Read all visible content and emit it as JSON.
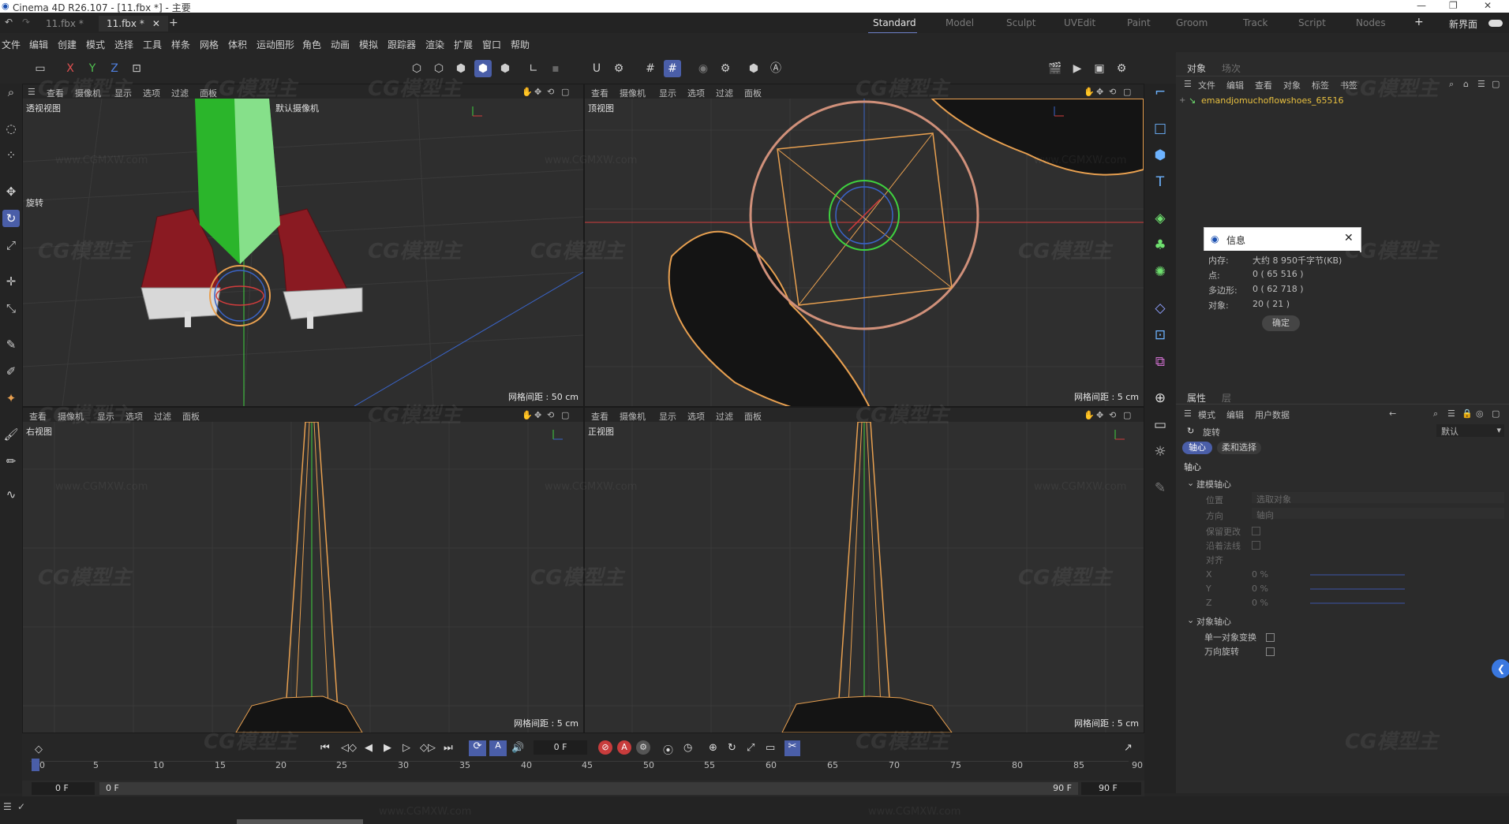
{
  "window": {
    "title": "Cinema 4D R26.107 - [11.fbx *] - 主要"
  },
  "doc_tabs": [
    {
      "label": "11.fbx *"
    },
    {
      "label": "11.fbx *"
    }
  ],
  "layout_tabs": [
    "Standard",
    "Model",
    "Sculpt",
    "UVEdit",
    "Paint",
    "Groom",
    "Track",
    "Script",
    "Nodes"
  ],
  "layout_extra": "新界面",
  "menu": [
    "文件",
    "编辑",
    "创建",
    "模式",
    "选择",
    "工具",
    "样条",
    "网格",
    "体积",
    "运动图形",
    "角色",
    "动画",
    "模拟",
    "跟踪器",
    "渲染",
    "扩展",
    "窗口",
    "帮助"
  ],
  "axis_buttons": [
    "X",
    "Y",
    "Z"
  ],
  "viewport_menu": [
    "查看",
    "摄像机",
    "显示",
    "选项",
    "过滤",
    "面板"
  ],
  "viewports": {
    "perspective": {
      "name": "透视视图",
      "camera": "默认摄像机",
      "rotate_label": "旋转",
      "grid": "网格间距 : 50 cm"
    },
    "top": {
      "name": "顶视图",
      "grid": "网格间距 : 5 cm"
    },
    "right": {
      "name": "右视图",
      "grid": "网格间距 : 5 cm"
    },
    "front": {
      "name": "正视图",
      "grid": "网格间距 : 5 cm"
    }
  },
  "object_panel": {
    "tab_active": "对象",
    "tab_inactive": "场次",
    "menu": [
      "文件",
      "编辑",
      "查看",
      "对象",
      "标签",
      "书签"
    ],
    "object_name": "emandjomuchoflowshoes_65516"
  },
  "info_dialog": {
    "title": "信息",
    "rows": [
      {
        "label": "内存:",
        "value": "大约 8 950千字节(KB)"
      },
      {
        "label": "点:",
        "value": "0 ( 65 516 )"
      },
      {
        "label": "多边形:",
        "value": "0 ( 62 718 )"
      },
      {
        "label": "对象:",
        "value": "20 ( 21 )"
      }
    ],
    "ok": "确定"
  },
  "attr_panel": {
    "tab_active": "属性",
    "tab_inactive": "层",
    "menu": [
      "模式",
      "编辑",
      "用户数据"
    ],
    "tool_name": "旋转",
    "preset": "默认",
    "subtabs": [
      "轴心",
      "柔和选择"
    ],
    "section": "轴心",
    "group1": "建模轴心",
    "position_label": "位置",
    "position_value": "选取对象",
    "direction_label": "方向",
    "direction_value": "轴向",
    "keep_changes": "保留更改",
    "along_normal": "沿着法线",
    "align_label": "对齐",
    "xyz": [
      {
        "axis": "X",
        "value": "0 %"
      },
      {
        "axis": "Y",
        "value": "0 %"
      },
      {
        "axis": "Z",
        "value": "0 %"
      }
    ],
    "group2": "对象轴心",
    "single_obj": "单一对象变换",
    "gimbal": "万向旋转"
  },
  "timeline": {
    "current_frame": "0 F",
    "ticks": [
      "0",
      "5",
      "10",
      "15",
      "20",
      "25",
      "30",
      "35",
      "40",
      "45",
      "50",
      "55",
      "60",
      "65",
      "70",
      "75",
      "80",
      "85",
      "90"
    ],
    "start": "0 F",
    "start2": "0 F",
    "end": "90 F",
    "end2": "90 F"
  },
  "watermark": {
    "logo": "CG模型主",
    "url": "www.CGMXW.com"
  },
  "colors": {
    "accent": "#4a5ea8",
    "icon_blue": "#6db3ff",
    "selection_orange": "#e8a050",
    "gizmo_green": "#3fd13f"
  }
}
